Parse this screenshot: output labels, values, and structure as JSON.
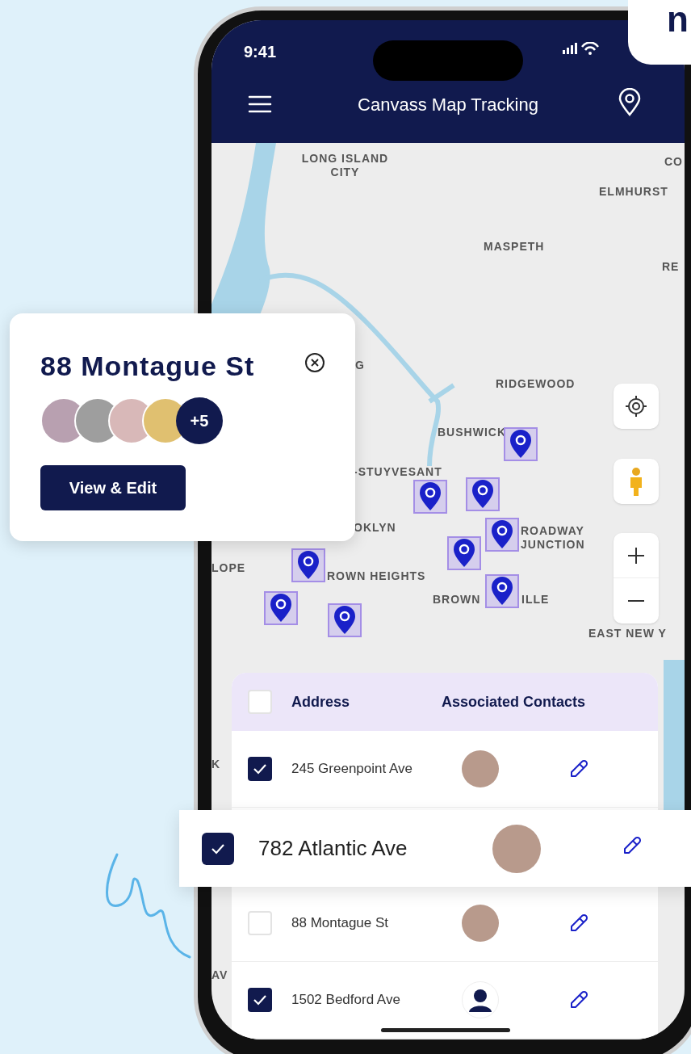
{
  "brand_logo": {
    "text": "n"
  },
  "status_bar": {
    "time": "9:41"
  },
  "nav_bar": {
    "title": "Canvass Map Tracking"
  },
  "map": {
    "labels": [
      "LONG ISLAND CITY",
      "CO",
      "ELMHURST",
      "MASPETH",
      "RE",
      "G",
      "RIDGEWOOD",
      "BUSHWICK",
      "-STUYVESANT",
      "OKLYN",
      "ROADWAY JUNCTION",
      "LOPE",
      "ROWN HEIGHTS",
      "BROWN",
      "ILLE",
      "EAST NEW Y",
      "K",
      "AV"
    ]
  },
  "popup": {
    "title": "88 Montague St",
    "extra_contacts": "+5",
    "button": "View & Edit"
  },
  "table": {
    "columns": [
      "Address",
      "Associated Contacts"
    ],
    "header_checked": false,
    "rows": [
      {
        "address": "245 Greenpoint Ave",
        "checked": true,
        "contact": {
          "kind": "photo"
        },
        "kind": "normal"
      },
      {
        "address": "782 Atlantic Ave",
        "checked": true,
        "contact": {
          "kind": "photo"
        },
        "kind": "floating"
      },
      {
        "address": "88 Montague St",
        "checked": false,
        "contact": {
          "kind": "photo"
        },
        "kind": "normal"
      },
      {
        "address": "1502 Bedford Ave",
        "checked": true,
        "contact": {
          "kind": "placeholder"
        },
        "kind": "normal"
      }
    ]
  }
}
